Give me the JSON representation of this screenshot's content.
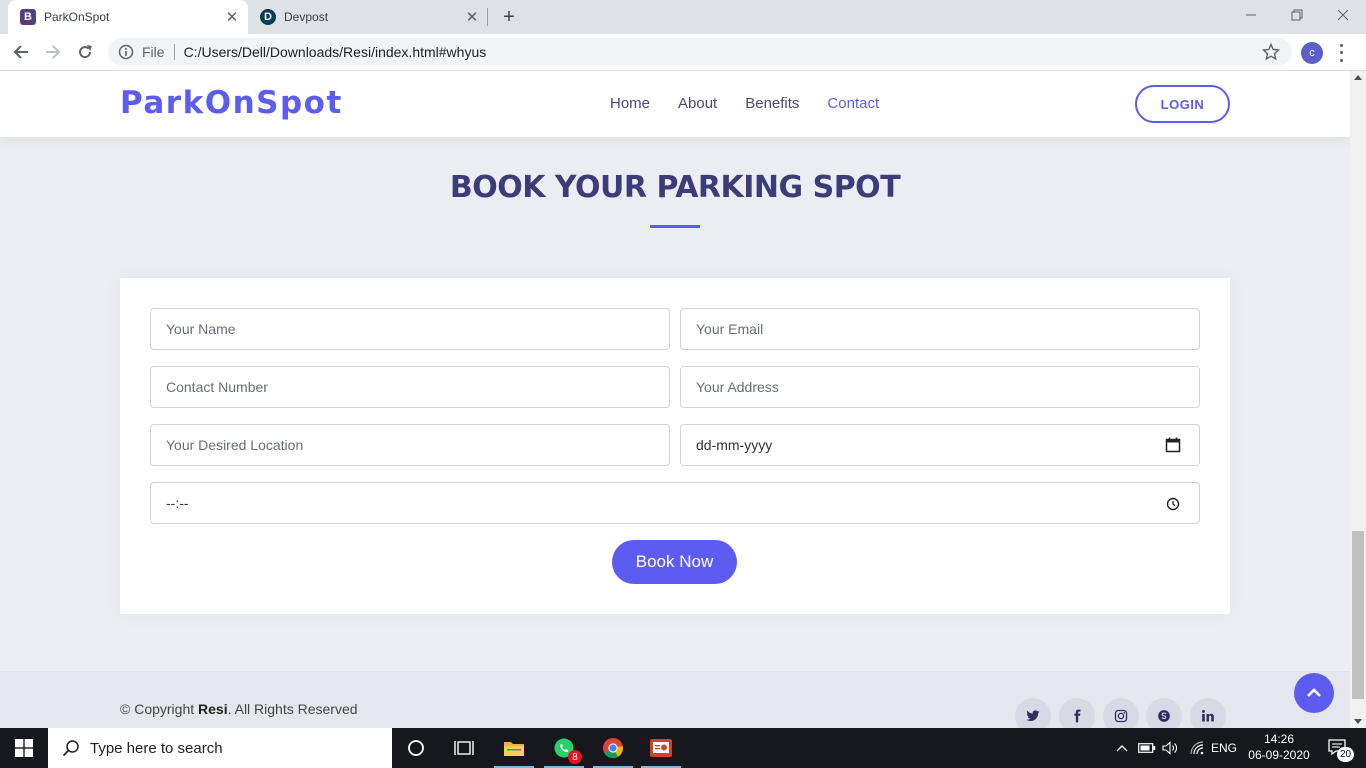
{
  "browser": {
    "tabs": [
      {
        "title": "ParkOnSpot",
        "favicon_letter": "B",
        "favicon_color": "#563d7c"
      },
      {
        "title": "Devpost",
        "favicon_letter": "D",
        "favicon_color": "#003e54"
      }
    ],
    "url_scheme_label": "File",
    "url": "C:/Users/Dell/Downloads/Resi/index.html#whyus",
    "profile_initial": "c"
  },
  "header": {
    "logo": "ParkOnSpot",
    "nav": [
      "Home",
      "About",
      "Benefits",
      "Contact"
    ],
    "active_nav": "Contact",
    "login_label": "LOGIN"
  },
  "section": {
    "title": "BOOK YOUR PARKING SPOT"
  },
  "form": {
    "name_placeholder": "Your Name",
    "email_placeholder": "Your Email",
    "contact_placeholder": "Contact Number",
    "address_placeholder": "Your Address",
    "location_placeholder": "Your Desired Location",
    "date_placeholder": "dd-mm-yyyy",
    "time_placeholder": "--:--",
    "submit_label": "Book Now"
  },
  "footer": {
    "copyright_prefix": "© Copyright ",
    "brand": "Resi",
    "copyright_suffix": ". All Rights Reserved",
    "social_icons": [
      "twitter-icon",
      "facebook-icon",
      "instagram-icon",
      "skype-icon",
      "linkedin-icon"
    ]
  },
  "taskbar": {
    "search_placeholder": "Type here to search",
    "whatsapp_badge": "8",
    "language": "ENG",
    "time": "14:26",
    "date": "06-09-2020",
    "notification_count": "20"
  },
  "colors": {
    "accent": "#5c5cf0",
    "title": "#3b3c78",
    "page_bg": "#ecedf3"
  }
}
